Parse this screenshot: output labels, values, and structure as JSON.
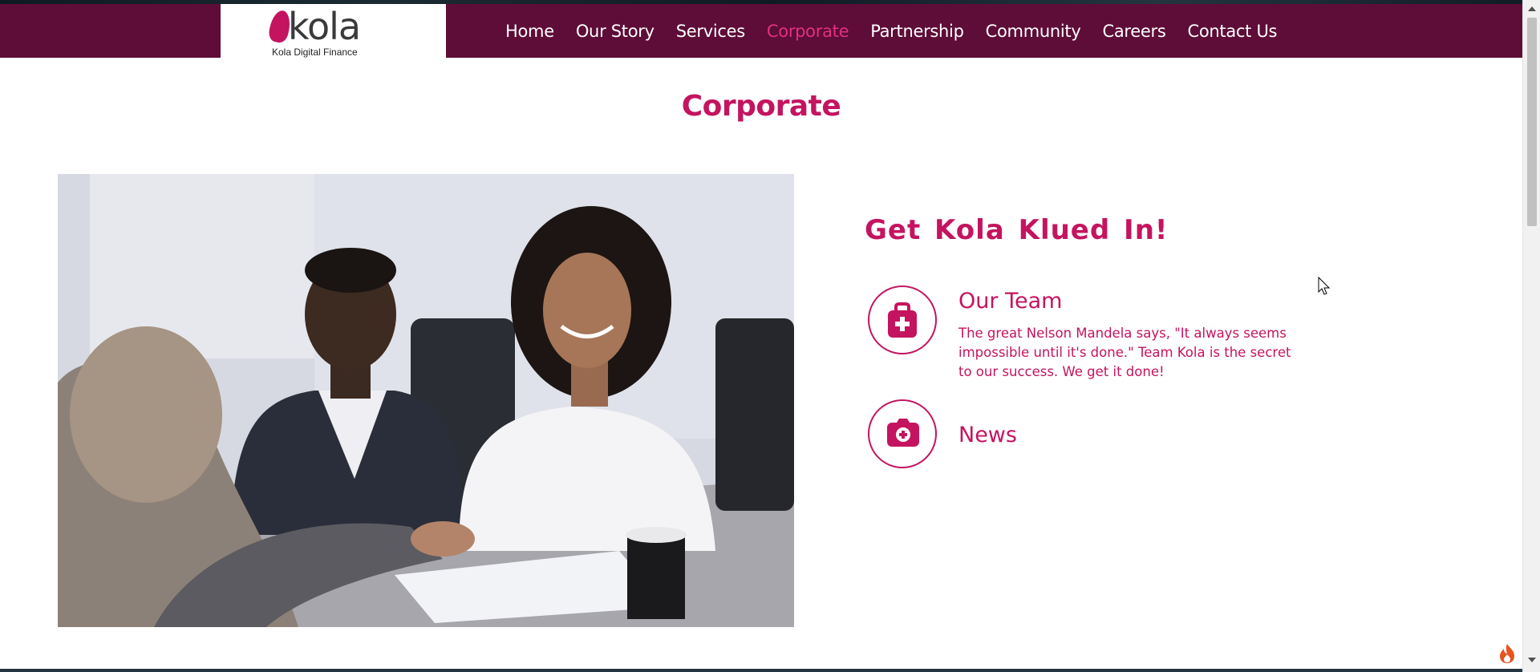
{
  "brand": {
    "wordmark": "kola",
    "tagline": "Kola Digital Finance"
  },
  "nav": {
    "items": [
      {
        "label": "Home",
        "active": false
      },
      {
        "label": "Our Story",
        "active": false
      },
      {
        "label": "Services",
        "active": false
      },
      {
        "label": "Corporate",
        "active": true
      },
      {
        "label": "Partnership",
        "active": false
      },
      {
        "label": "Community",
        "active": false
      },
      {
        "label": "Careers",
        "active": false
      },
      {
        "label": "Contact Us",
        "active": false
      }
    ]
  },
  "page": {
    "title": "Corporate"
  },
  "content": {
    "heading": "Get Kola Klued In!",
    "features": [
      {
        "icon": "medical-bag-icon",
        "title": "Our Team",
        "text": "The great Nelson Mandela says, \"It always seems impossible until it's done.\" Team Kola is the secret to our success. We get it done!"
      },
      {
        "icon": "camera-icon",
        "title": "News",
        "text": ""
      }
    ]
  },
  "colors": {
    "header_bg": "#5e0c38",
    "accent": "#c4145f",
    "active_nav": "#e0317e"
  }
}
